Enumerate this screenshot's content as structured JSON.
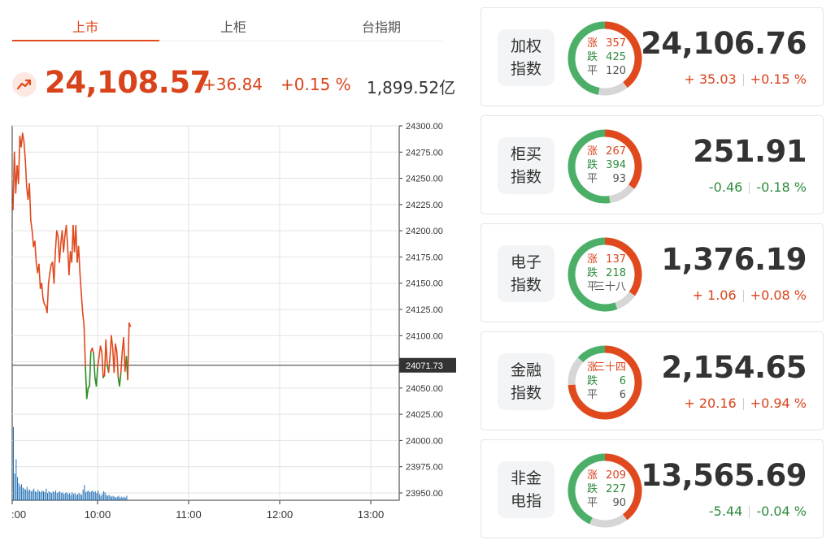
{
  "tabs": [
    {
      "label": "上市",
      "active": true
    },
    {
      "label": "上柜",
      "active": false
    },
    {
      "label": "台指期",
      "active": false
    }
  ],
  "quote": {
    "price": "24,108.57",
    "change": "+36.84",
    "change_pct": "+0.15 %",
    "volume": "1,899.52亿",
    "trend_icon": "trend-up-icon"
  },
  "chart_data": {
    "type": "line",
    "y_ticks": [
      "24300.00",
      "24275.00",
      "24250.00",
      "24225.00",
      "24200.00",
      "24175.00",
      "24150.00",
      "24125.00",
      "24100.00",
      "24075.00",
      "24050.00",
      "24025.00",
      "24000.00",
      "23975.00",
      "23950.00"
    ],
    "ylim": [
      23943,
      24300
    ],
    "x_ticks": [
      ":00",
      "10:00",
      "11:00",
      "12:00",
      "13:00"
    ],
    "reference_label": "24071.73",
    "reference_value": 24071.73,
    "colors": {
      "up": "#e0491d",
      "down": "#2a8a22",
      "volume": "#1f6fb5",
      "ref": "#333333"
    },
    "x_minutes": [
      0,
      1,
      2,
      3,
      4,
      5,
      6,
      7,
      8,
      9,
      10,
      11,
      12,
      13,
      14,
      15,
      16,
      17,
      18,
      19,
      20,
      21,
      22,
      23,
      24,
      25,
      26,
      27,
      28,
      29,
      30,
      31,
      32,
      33,
      34,
      35,
      36,
      37,
      38,
      39,
      40,
      41,
      42,
      43,
      44,
      45,
      46,
      47,
      48,
      49,
      50,
      51,
      52,
      53,
      54,
      55,
      56,
      57,
      58,
      59,
      60,
      61,
      62,
      63,
      64,
      65,
      66,
      67,
      68,
      69,
      70,
      71,
      72,
      73,
      74,
      75,
      76,
      77,
      78,
      79,
      80,
      81,
      82,
      83
    ],
    "values": [
      24220,
      24275,
      24236,
      24262,
      24245,
      24290,
      24280,
      24293,
      24285,
      24268,
      24242,
      24230,
      24245,
      24210,
      24200,
      24185,
      24190,
      24170,
      24160,
      24168,
      24145,
      24150,
      24135,
      24130,
      24128,
      24122,
      24150,
      24160,
      24168,
      24170,
      24150,
      24180,
      24200,
      24195,
      24170,
      24188,
      24200,
      24180,
      24195,
      24205,
      24185,
      24158,
      24180,
      24170,
      24205,
      24180,
      24205,
      24170,
      24185,
      24160,
      24140,
      24122,
      24110,
      24070,
      24040,
      24050,
      24052,
      24085,
      24088,
      24083,
      24060,
      24052,
      24070,
      24080,
      24090,
      24085,
      24060,
      24062,
      24096,
      24072,
      24065,
      24080,
      24100,
      24088,
      24065,
      24092,
      24085,
      24060,
      24052,
      24065,
      24085,
      24098,
      24066,
      24080,
      24058,
      24112,
      24109
    ],
    "volume": [
      0.82,
      0.3,
      0.46,
      0.26,
      0.19,
      0.16,
      0.18,
      0.14,
      0.13,
      0.12,
      0.15,
      0.11,
      0.12,
      0.1,
      0.11,
      0.13,
      0.1,
      0.09,
      0.12,
      0.1,
      0.09,
      0.11,
      0.1,
      0.09,
      0.13,
      0.08,
      0.1,
      0.09,
      0.08,
      0.1,
      0.09,
      0.11,
      0.08,
      0.09,
      0.1,
      0.08,
      0.09,
      0.07,
      0.08,
      0.09,
      0.07,
      0.08,
      0.06,
      0.09,
      0.07,
      0.08,
      0.06,
      0.07,
      0.08,
      0.07,
      0.06,
      0.12,
      0.17,
      0.09,
      0.1,
      0.11,
      0.09,
      0.1,
      0.11,
      0.09,
      0.1,
      0.08,
      0.11,
      0.07,
      0.05,
      0.07,
      0.1,
      0.09,
      0.06,
      0.05,
      0.06,
      0.05,
      0.04,
      0.05,
      0.04,
      0.03,
      0.04,
      0.05,
      0.03,
      0.04,
      0.03,
      0.04,
      0.03,
      0.05
    ]
  },
  "indices": [
    {
      "name1": "加权",
      "name2": "指数",
      "up_label": "涨",
      "up": "357",
      "down_label": "跌",
      "down": "425",
      "flat_label": "平",
      "flat": "120",
      "up_count": 357,
      "down_count": 425,
      "flat_count": 120,
      "price": "24,106.76",
      "change": "+ 35.03",
      "pct": "+0.15 %",
      "dir": "pos"
    },
    {
      "name1": "柜买",
      "name2": "指数",
      "up_label": "涨",
      "up": "267",
      "down_label": "跌",
      "down": "394",
      "flat_label": "平",
      "flat": "93",
      "up_count": 267,
      "down_count": 394,
      "flat_count": 93,
      "price": "251.91",
      "change": "-0.46",
      "pct": "-0.18 %",
      "dir": "neg"
    },
    {
      "name1": "电子",
      "name2": "指数",
      "up_label": "涨",
      "up": "137",
      "down_label": "跌",
      "down": "218",
      "flat_label": "平",
      "flat": "三十八",
      "up_count": 137,
      "down_count": 218,
      "flat_count": 38,
      "price": "1,376.19",
      "change": "+ 1.06",
      "pct": "+0.08 %",
      "dir": "pos"
    },
    {
      "name1": "金融",
      "name2": "指数",
      "up_label": "涨",
      "up": "三十四",
      "down_label": "跌",
      "down": "6",
      "flat_label": "平",
      "flat": "6",
      "up_count": 34,
      "down_count": 6,
      "flat_count": 6,
      "price": "2,154.65",
      "change": "+ 20.16",
      "pct": "+0.94 %",
      "dir": "pos"
    },
    {
      "name1": "非金",
      "name2": "电指",
      "up_label": "涨",
      "up": "209",
      "down_label": "跌",
      "down": "227",
      "flat_label": "平",
      "flat": "90",
      "up_count": 209,
      "down_count": 227,
      "flat_count": 90,
      "price": "13,565.69",
      "change": "-5.44",
      "pct": "-0.04 %",
      "dir": "neg"
    }
  ],
  "donut_colors": {
    "up": "#e0491d",
    "down": "#4caf68",
    "flat": "#d6d6d6"
  }
}
